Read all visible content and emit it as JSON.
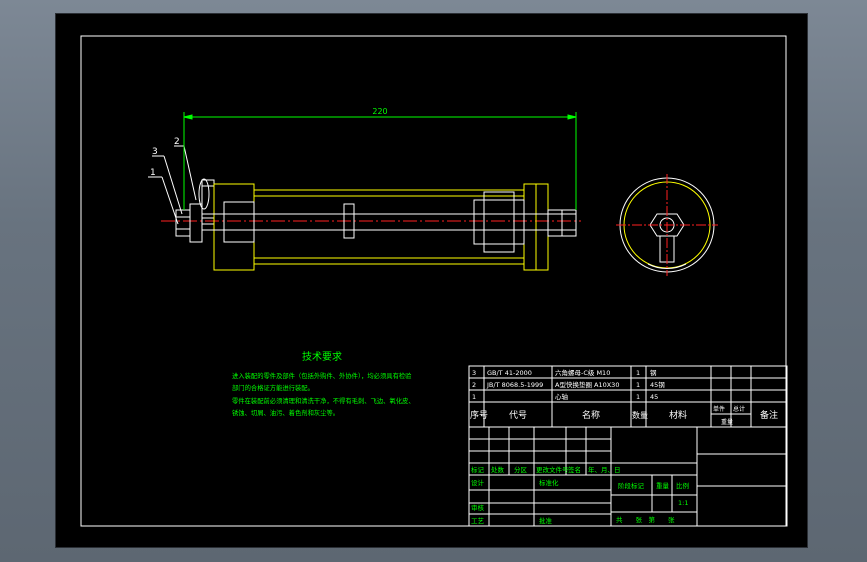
{
  "dimension": {
    "length": "220"
  },
  "balloons": [
    "3",
    "2",
    "1"
  ],
  "tech_requirements": {
    "title": "技术要求",
    "lines": [
      "进入装配的零件及部件（包括外购件、外协件），均必须具有检验",
      "部门的合格证方能进行装配。",
      "零件在装配前必须清理和清洗干净，不得有毛刺、飞边、氧化皮、",
      "锈蚀、切屑、油污、着色剂和灰尘等。"
    ]
  },
  "bom": {
    "rows": [
      {
        "no": "3",
        "code": "GB/T 41-2000",
        "name": "六角螺母-C级 M10",
        "qty": "1",
        "material": "钢"
      },
      {
        "no": "2",
        "code": "JB/T 8068.5-1999",
        "name": "A型快换垫圈 A10X30",
        "qty": "1",
        "material": "45钢"
      },
      {
        "no": "1",
        "code": "",
        "name": "心轴",
        "qty": "1",
        "material": "45"
      }
    ],
    "headers": {
      "no": "序号",
      "code": "代号",
      "name": "名称",
      "qty": "数量",
      "material": "材料",
      "unit": "单件",
      "total": "总计",
      "weight": "重量",
      "remark": "备注"
    }
  },
  "title_block": {
    "row_labels": [
      "标记",
      "处数",
      "分区",
      "更改文件号",
      "签名",
      "年、月、日"
    ],
    "design": "设计",
    "standard": "标准化",
    "review": "审核",
    "process": "工艺",
    "approve": "批准",
    "stage_mark": "阶段标记",
    "weight": "重量",
    "scale": "比例",
    "scale_value": "1:1",
    "sheets": "共　　张　第　　张"
  },
  "colors": {
    "outline": "#ffffff",
    "part": "#ffff00",
    "center": "#ff2020",
    "dim": "#00ff00",
    "text": "#00ff00",
    "viewport": "#000000"
  }
}
